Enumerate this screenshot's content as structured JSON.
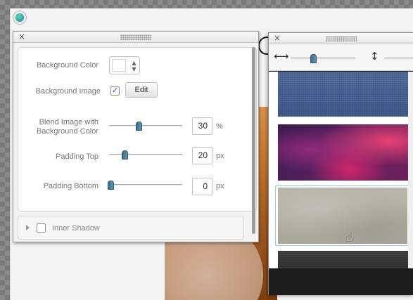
{
  "canvas": {
    "accent_color": "#2aa39b"
  },
  "properties_panel": {
    "close_icon": "×",
    "background_color_label": "Background Color",
    "color_stepper_icon": "▲▼",
    "background_image_label": "Background Image",
    "background_image_checked": true,
    "edit_label": "Edit",
    "blend_label_line1": "Blend Image with",
    "blend_label_line2": "Background Color",
    "blend_value": "30",
    "blend_unit": "%",
    "blend_fraction": 0.3,
    "padding_top_label": "Padding Top",
    "padding_top_value": "20",
    "padding_top_unit": "px",
    "padding_bottom_label": "Padding Bottom",
    "padding_bottom_value": "0",
    "padding_bottom_unit": "px",
    "inner_shadow_label": "Inner Shadow",
    "inner_shadow_checked": false
  },
  "texture_panel": {
    "close_icon": "×",
    "width_icon": "⟷",
    "height_icon": "↕",
    "textures": [
      "denim",
      "purple-abstract",
      "stone",
      "dark-fabric"
    ],
    "selected_texture": "stone"
  }
}
